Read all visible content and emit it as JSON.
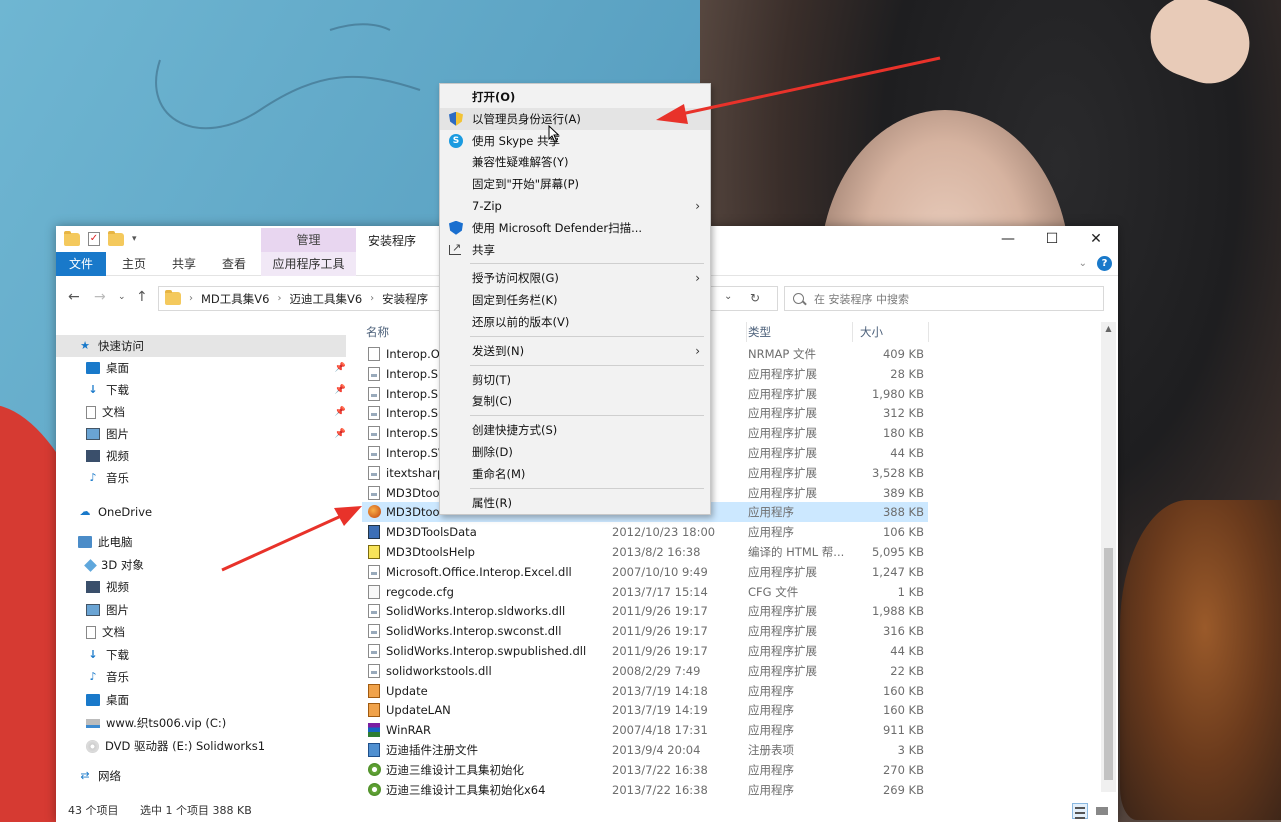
{
  "window": {
    "manage_tab": "管理",
    "title": "安装程序",
    "ribbon_tabs": [
      "文件",
      "主页",
      "共享",
      "查看",
      "应用程序工具"
    ],
    "minimize": "—",
    "maximize": "☐",
    "close": "✕",
    "help": "?"
  },
  "address": {
    "crumbs": [
      "MD工具集V6",
      "迈迪工具集V6",
      "安装程序"
    ],
    "search_placeholder": "在 安装程序 中搜索"
  },
  "nav": {
    "quick_access": "快速访问",
    "quick_items": [
      "桌面",
      "下载",
      "文档",
      "图片",
      "视频",
      "音乐"
    ],
    "onedrive": "OneDrive",
    "this_pc": "此电脑",
    "pc_items": [
      "3D 对象",
      "视频",
      "图片",
      "文档",
      "下载",
      "音乐",
      "桌面"
    ],
    "drive_c": "www.织ts006.vip (C:)",
    "drive_e": "DVD 驱动器 (E:) Solidworks1",
    "network": "网络"
  },
  "columns": {
    "name": "名称",
    "type": "类型",
    "size": "大小"
  },
  "files": [
    {
      "name": "Interop.O",
      "date": "",
      "type": "NRMAP 文件",
      "size": "409 KB",
      "icon": "doc"
    },
    {
      "name": "Interop.SI",
      "date": "",
      "type": "应用程序扩展",
      "size": "28 KB",
      "icon": "dll"
    },
    {
      "name": "Interop.SI",
      "date": "",
      "type": "应用程序扩展",
      "size": "1,980 KB",
      "icon": "dll"
    },
    {
      "name": "Interop.Su",
      "date": "",
      "type": "应用程序扩展",
      "size": "312 KB",
      "icon": "dll"
    },
    {
      "name": "Interop.Su",
      "date": "",
      "type": "应用程序扩展",
      "size": "180 KB",
      "icon": "dll"
    },
    {
      "name": "Interop.SV",
      "date": "",
      "type": "应用程序扩展",
      "size": "44 KB",
      "icon": "dll"
    },
    {
      "name": "itextsharp",
      "date": "",
      "type": "应用程序扩展",
      "size": "3,528 KB",
      "icon": "dll"
    },
    {
      "name": "MD3Dtoo",
      "date": "",
      "type": "应用程序扩展",
      "size": "389 KB",
      "icon": "dll"
    },
    {
      "name": "MD3Dtoo",
      "date": "",
      "type": "应用程序",
      "size": "388 KB",
      "icon": "app",
      "selected": true
    },
    {
      "name": "MD3DToolsData",
      "date": "2012/10/23 18:00",
      "type": "应用程序",
      "size": "106 KB",
      "icon": "db"
    },
    {
      "name": "MD3DtoolsHelp",
      "date": "2013/8/2 16:38",
      "type": "编译的 HTML 帮...",
      "size": "5,095 KB",
      "icon": "help"
    },
    {
      "name": "Microsoft.Office.Interop.Excel.dll",
      "date": "2007/10/10 9:49",
      "type": "应用程序扩展",
      "size": "1,247 KB",
      "icon": "dll"
    },
    {
      "name": "regcode.cfg",
      "date": "2013/7/17 15:14",
      "type": "CFG 文件",
      "size": "1 KB",
      "icon": "cfg"
    },
    {
      "name": "SolidWorks.Interop.sldworks.dll",
      "date": "2011/9/26 19:17",
      "type": "应用程序扩展",
      "size": "1,988 KB",
      "icon": "dll"
    },
    {
      "name": "SolidWorks.Interop.swconst.dll",
      "date": "2011/9/26 19:17",
      "type": "应用程序扩展",
      "size": "316 KB",
      "icon": "dll"
    },
    {
      "name": "SolidWorks.Interop.swpublished.dll",
      "date": "2011/9/26 19:17",
      "type": "应用程序扩展",
      "size": "44 KB",
      "icon": "dll"
    },
    {
      "name": "solidworkstools.dll",
      "date": "2008/2/29 7:49",
      "type": "应用程序扩展",
      "size": "22 KB",
      "icon": "dll"
    },
    {
      "name": "Update",
      "date": "2013/7/19 14:18",
      "type": "应用程序",
      "size": "160 KB",
      "icon": "appicon"
    },
    {
      "name": "UpdateLAN",
      "date": "2013/7/19 14:19",
      "type": "应用程序",
      "size": "160 KB",
      "icon": "appicon"
    },
    {
      "name": "WinRAR",
      "date": "2007/4/18 17:31",
      "type": "应用程序",
      "size": "911 KB",
      "icon": "rar"
    },
    {
      "name": "迈迪插件注册文件",
      "date": "2013/9/4 20:04",
      "type": "注册表项",
      "size": "3 KB",
      "icon": "reg"
    },
    {
      "name": "迈迪三维设计工具集初始化",
      "date": "2013/7/22 16:38",
      "type": "应用程序",
      "size": "270 KB",
      "icon": "gear"
    },
    {
      "name": "迈迪三维设计工具集初始化x64",
      "date": "2013/7/22 16:38",
      "type": "应用程序",
      "size": "269 KB",
      "icon": "gear"
    }
  ],
  "status": {
    "count": "43 个项目",
    "selected": "选中 1 个项目  388 KB"
  },
  "context_menu": {
    "items": [
      {
        "label": "打开(O)",
        "bold": true
      },
      {
        "label": "以管理员身份运行(A)",
        "icon": "shield",
        "hover": true
      },
      {
        "label": "使用 Skype 共享",
        "icon": "skype"
      },
      {
        "label": "兼容性疑难解答(Y)"
      },
      {
        "label": "固定到\"开始\"屏幕(P)"
      },
      {
        "label": "7-Zip",
        "submenu": true
      },
      {
        "label": "使用 Microsoft Defender扫描...",
        "icon": "defender"
      },
      {
        "label": "共享",
        "icon": "share"
      },
      {
        "sep": true
      },
      {
        "label": "授予访问权限(G)",
        "submenu": true
      },
      {
        "label": "固定到任务栏(K)"
      },
      {
        "label": "还原以前的版本(V)"
      },
      {
        "sep": true
      },
      {
        "label": "发送到(N)",
        "submenu": true
      },
      {
        "sep": true
      },
      {
        "label": "剪切(T)"
      },
      {
        "label": "复制(C)"
      },
      {
        "sep": true
      },
      {
        "label": "创建快捷方式(S)"
      },
      {
        "label": "删除(D)"
      },
      {
        "label": "重命名(M)"
      },
      {
        "sep": true
      },
      {
        "label": "属性(R)"
      }
    ]
  },
  "colors": {
    "accent": "#1979ca",
    "arrow": "#e8322a",
    "selected_row": "#cce8ff"
  }
}
